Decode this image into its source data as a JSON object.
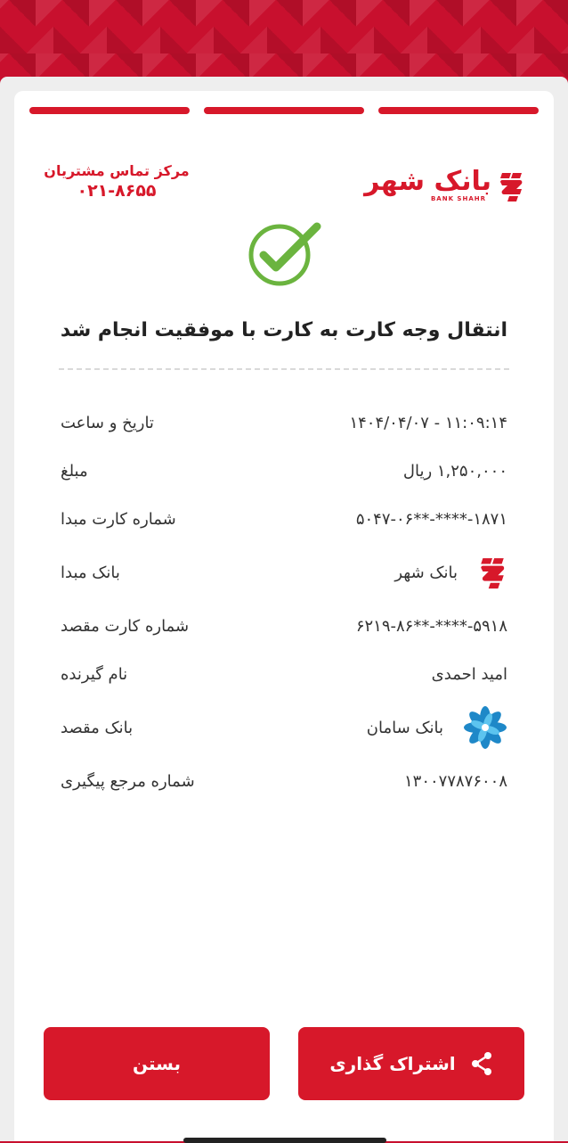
{
  "header": {
    "brand_fa": "بانک شهر",
    "brand_en": "BANK SHAHR",
    "support_title": "مرکز تماس مشتریان",
    "support_phone": "۰۲۱-۸۶۵۵"
  },
  "steps": {
    "total": 3,
    "completed": 3
  },
  "receipt": {
    "title": "انتقال وجه کارت به کارت با موفقیت انجام شد",
    "rows": [
      {
        "label": "تاریخ و ساعت",
        "value": "۱۴۰۴/۰۴/۰۷ - ۱۱:۰۹:۱۴"
      },
      {
        "label": "مبلغ",
        "value": "۱,۲۵۰,۰۰۰ ریال"
      },
      {
        "label": "شماره کارت مبدا",
        "value": "۵۰۴۷-۰۶**-****-۱۸۷۱"
      },
      {
        "label": "بانک مبدا",
        "value": "بانک شهر",
        "icon": "bank-shahr-logo-icon"
      },
      {
        "label": "شماره کارت مقصد",
        "value": "۶۲۱۹-۸۶**-****-۵۹۱۸"
      },
      {
        "label": "نام گیرنده",
        "value": "امید احمدی"
      },
      {
        "label": "بانک مقصد",
        "value": "بانک سامان",
        "icon": "bank-saman-logo-icon"
      },
      {
        "label": "شماره مرجع پیگیری",
        "value": "۱۳۰۰۷۷۸۷۶۰۰۸"
      }
    ]
  },
  "actions": {
    "share_label": "اشتراک گذاری",
    "close_label": "بستن"
  },
  "colors": {
    "brand": "#d7182a",
    "success": "#6bb43f",
    "saman": "#1e88c8"
  }
}
